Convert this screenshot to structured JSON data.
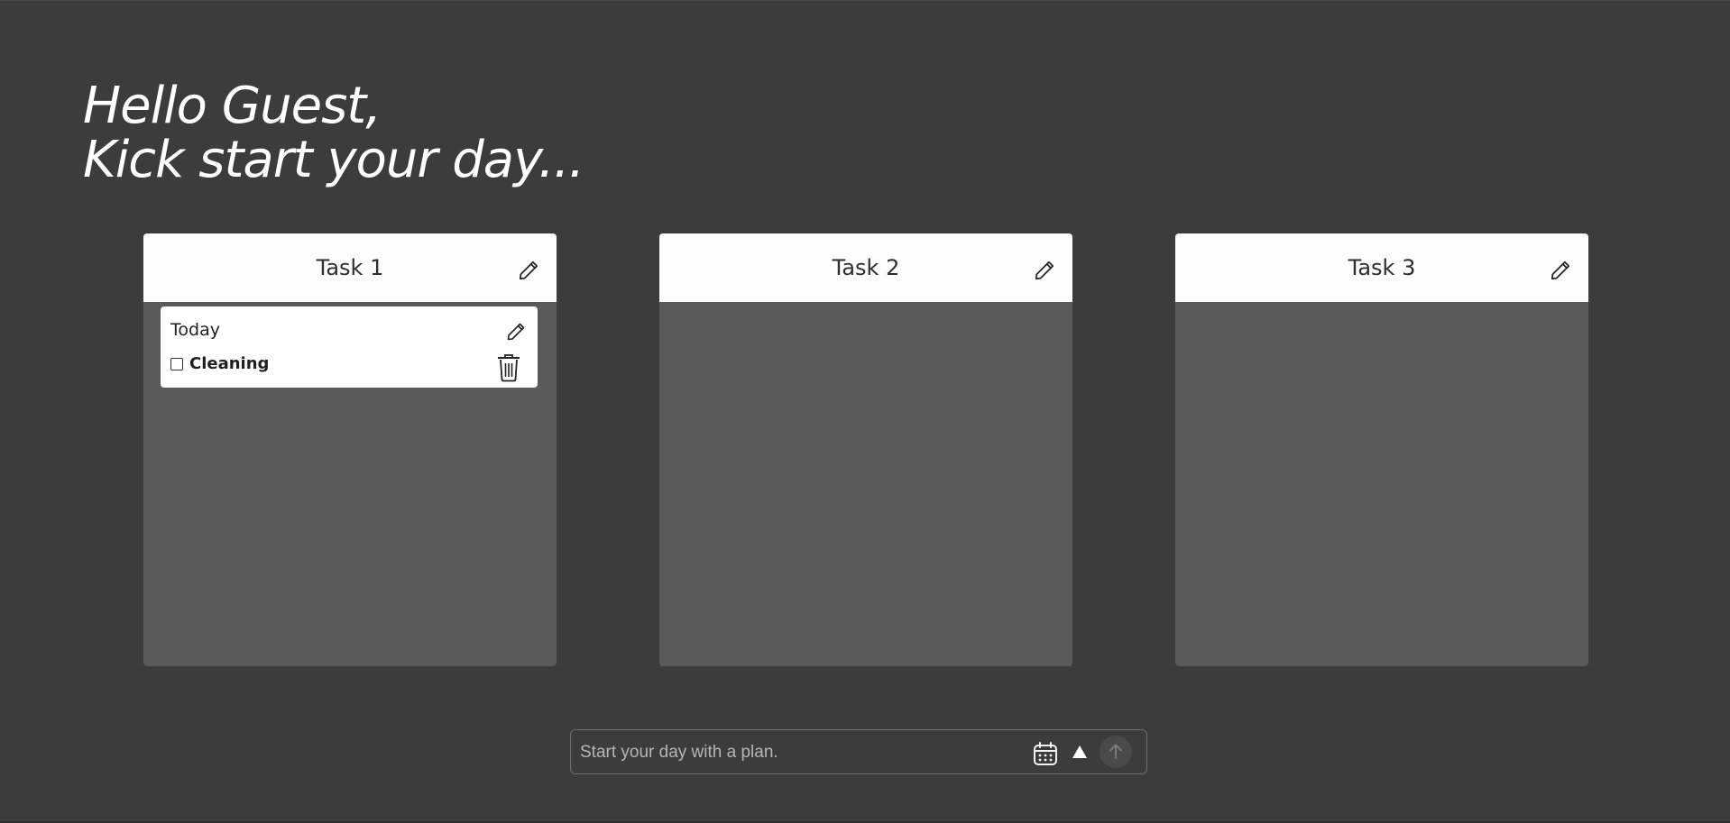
{
  "greeting": {
    "line1": "Hello Guest,",
    "line2": "Kick start your day..."
  },
  "boards": [
    {
      "title": "Task 1",
      "cards": [
        {
          "title": "Today",
          "tasks": [
            {
              "label": "Cleaning",
              "checked": false
            }
          ]
        }
      ]
    },
    {
      "title": "Task 2",
      "cards": []
    },
    {
      "title": "Task 3",
      "cards": []
    }
  ],
  "composer": {
    "placeholder": "Start your day with a plan.",
    "icons": [
      "calendar-icon",
      "triangle-up-icon",
      "arrow-up-icon"
    ]
  },
  "colors": {
    "background": "#3c3c3b",
    "board_body": "#5a5a59",
    "board_header": "#fdfdfc",
    "text_light": "#ffffff"
  }
}
